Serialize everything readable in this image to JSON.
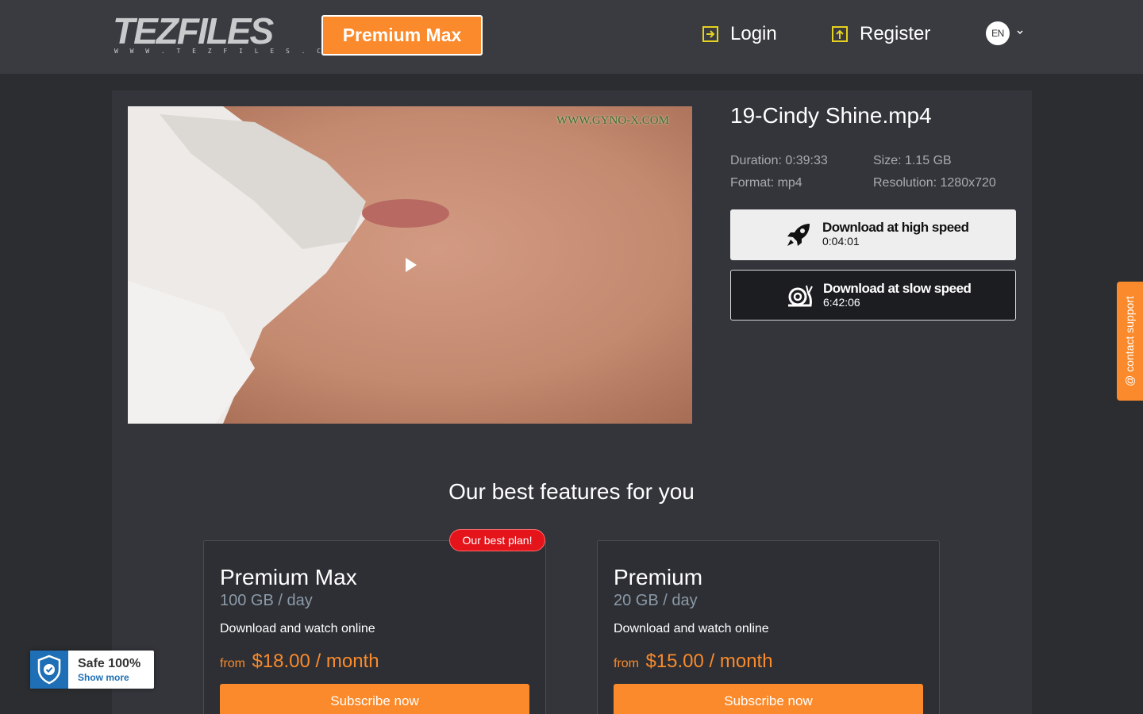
{
  "brand": {
    "logo_text": "TEZFILES",
    "logo_sub": "W W W . T E Z F I L E S . C O M"
  },
  "header": {
    "premium_button": "Premium Max",
    "login_label": "Login",
    "register_label": "Register",
    "language": "EN"
  },
  "file": {
    "title": "19-Cindy Shine.mp4",
    "duration": "Duration: 0:39:33",
    "size": "Size: 1.15 GB",
    "format": "Format: mp4",
    "resolution": "Resolution: 1280x720",
    "video_watermark": "WWW.GYNO-X.COM"
  },
  "download": {
    "fast": {
      "label": "Download at high speed",
      "time": "0:04:01",
      "icon": "rocket-icon"
    },
    "slow": {
      "label": "Download at slow speed",
      "time": "6:42:06",
      "icon": "snail-icon"
    }
  },
  "features": {
    "title": "Our best features for you",
    "best_badge": "Our best plan!",
    "plans": [
      {
        "name": "Premium Max",
        "quota": "100 GB / day",
        "desc": "Download and watch online",
        "from": "from",
        "price": "$18.00 / month",
        "button": "Subscribe now"
      },
      {
        "name": "Premium",
        "quota": "20 GB / day",
        "desc": "Download and watch online",
        "from": "from",
        "price": "$15.00 / month",
        "button": "Subscribe now"
      }
    ]
  },
  "support": {
    "label": "@ contact support"
  },
  "safe_badge": {
    "title": "Safe 100%",
    "link": "Show more"
  },
  "colors": {
    "accent": "#fa8a2b",
    "background": "#2b2d31",
    "header": "#393b40",
    "badge_red": "#e5141b",
    "shield_blue": "#1e6fb5"
  }
}
